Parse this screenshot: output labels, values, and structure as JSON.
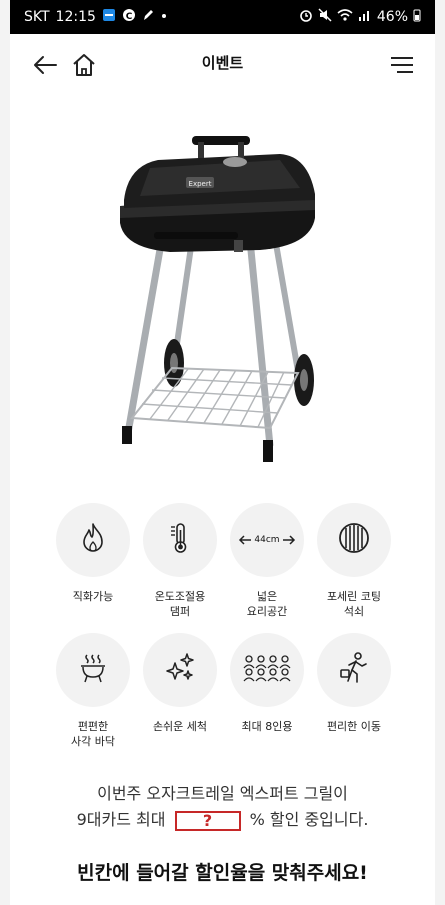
{
  "status_bar": {
    "carrier": "SKT",
    "time": "12:15",
    "battery": "46%",
    "icons": [
      "app-icon",
      "c-icon",
      "pen-icon",
      "dot-icon",
      "alarm-icon",
      "mute-icon",
      "wifi-icon",
      "signal-icon",
      "battery-icon"
    ]
  },
  "header": {
    "title": "이벤트",
    "icons": [
      "back-arrow-icon",
      "home-icon",
      "menu-icon"
    ]
  },
  "product": {
    "image": "charcoal-grill-image",
    "brand_badge": "Expert"
  },
  "features": [
    {
      "icon": "flame-icon",
      "label": "직화가능"
    },
    {
      "icon": "thermometer-icon",
      "label": "온도조절용\n댐퍼"
    },
    {
      "icon": "width-arrows-icon",
      "icon_text": "44cm",
      "label": "넓은\n요리공간"
    },
    {
      "icon": "porcelain-grate-icon",
      "label": "포세린 코팅\n석쇠"
    },
    {
      "icon": "grill-steam-icon",
      "label": "편편한\n사각 바닥"
    },
    {
      "icon": "sparkle-icon",
      "label": "손쉬운 세척"
    },
    {
      "icon": "people-group-icon",
      "label": "최대 8인용"
    },
    {
      "icon": "walking-person-icon",
      "label": "편리한 이동"
    }
  ],
  "question": {
    "line1": "이번주 오자크트레일 엑스퍼트 그릴이",
    "line2_prefix": "9대카드 최대",
    "blank": "?",
    "line2_suffix": "% 할인 중입니다."
  },
  "cta": "빈칸에 들어갈 할인율을 맞춰주세요!"
}
